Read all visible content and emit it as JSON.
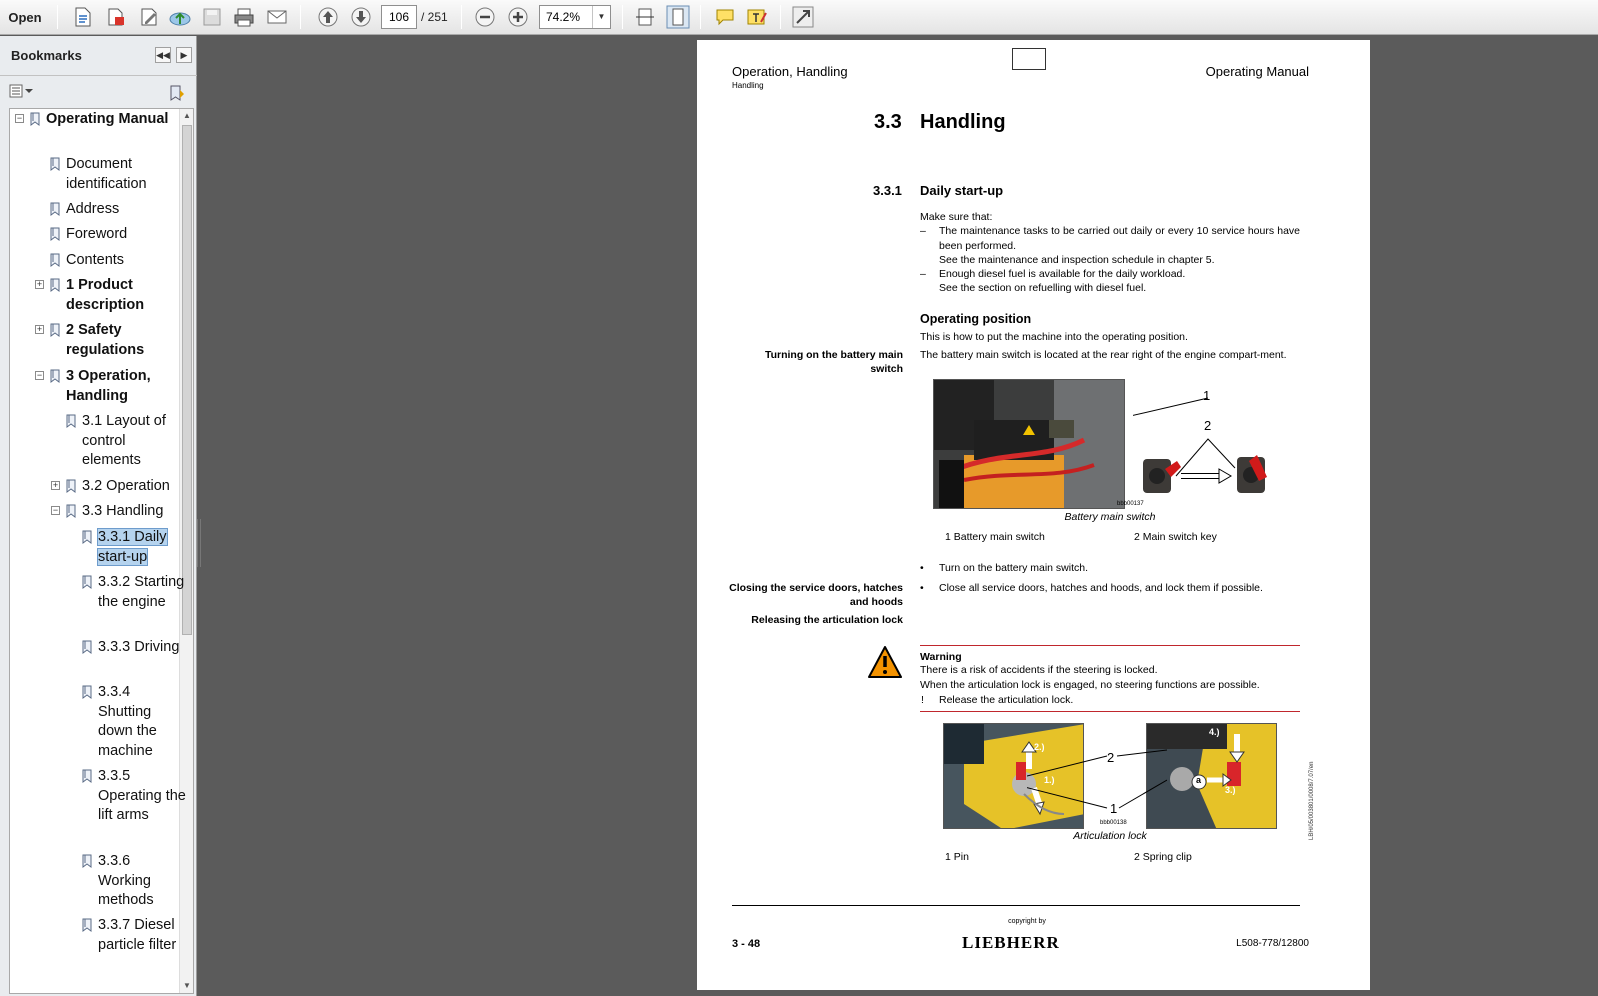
{
  "toolbar": {
    "open_label": "Open",
    "page_current": "106",
    "page_total": "/ 251",
    "zoom": "74.2%"
  },
  "sidebar": {
    "title": "Bookmarks",
    "items": [
      {
        "label": "Operating Manual",
        "bold": true
      },
      {
        "label": "Document identification"
      },
      {
        "label": "Address"
      },
      {
        "label": "Foreword"
      },
      {
        "label": "Contents"
      },
      {
        "label": "1 Product description",
        "bold": true
      },
      {
        "label": "2 Safety regulations",
        "bold": true
      },
      {
        "label": "3 Operation, Handling",
        "bold": true
      },
      {
        "label": "3.1 Layout of control elements"
      },
      {
        "label": "3.2 Operation"
      },
      {
        "label": "3.3 Handling"
      },
      {
        "label": "3.3.1 Daily start-up",
        "selected": true
      },
      {
        "label": "3.3.2 Starting the engine"
      },
      {
        "label": "3.3.3 Driving"
      },
      {
        "label": "3.3.4 Shutting down the machine"
      },
      {
        "label": "3.3.5 Operating the lift arms"
      },
      {
        "label": "3.3.6 Working methods"
      },
      {
        "label": "3.3.7 Diesel particle filter"
      }
    ]
  },
  "doc": {
    "header_left": "Operation, Handling",
    "header_left_sub": "Handling",
    "header_right": "Operating Manual",
    "section_num": "3.3",
    "section_title": "Handling",
    "sub_num": "3.3.1",
    "sub_title": "Daily start-up",
    "intro": "Make sure that:",
    "dash1_a": "The maintenance tasks to be carried out daily or every 10 service hours have been performed.",
    "dash1_b": "See the maintenance and inspection schedule in chapter 5.",
    "dash2_a": "Enough diesel fuel is available for the daily workload.",
    "dash2_b": "See the section on refuelling with diesel fuel.",
    "op_heading": "Operating position",
    "op_text": "This is how to put the machine into the operating position.",
    "side_battery": "Turning on the battery main switch",
    "battery_text": "The battery main switch is located at the rear right of the engine compart-ment.",
    "fig1_code": "bbb00137",
    "fig1_caption": "Battery main switch",
    "fig1_label1": "1",
    "fig1_label2": "2",
    "fig1_legend1": "1  Battery main switch",
    "fig1_legend2": "2  Main switch key",
    "bullet1": "Turn on the battery main switch.",
    "side_doors": "Closing the service doors, hatches and hoods",
    "bullet2": "Close all service doors, hatches and hoods, and lock them if possible.",
    "side_artic": "Releasing the articulation lock",
    "warn_title": "Warning",
    "warn_line1": "There is a risk of accidents if the steering is locked.",
    "warn_line2": "When the articulation lock is engaged, no steering functions are possible.",
    "warn_line3": "Release the articulation lock.",
    "fig2_code": "bbb00138",
    "fig2_caption": "Articulation lock",
    "fig2_callouts": [
      "2.)",
      "1.)",
      "4.)",
      "a",
      "3.)",
      "2",
      "1"
    ],
    "fig2_legend1": "1  Pin",
    "fig2_legend2": "2  Spring clip",
    "copyright": "copyright by",
    "logo": "LIEBHERR",
    "page_num": "3 - 48",
    "doc_id": "L508-778/12800",
    "vertical_code": "LBH/05/003801/0008/7.07/en"
  },
  "colors": {
    "toolbar_bg": "#e9e9e9",
    "workspace_bg": "#5b5b5b",
    "selection": "#b5d3ee",
    "warning_rule": "#c0272d",
    "warning_icon": "#f39200"
  }
}
